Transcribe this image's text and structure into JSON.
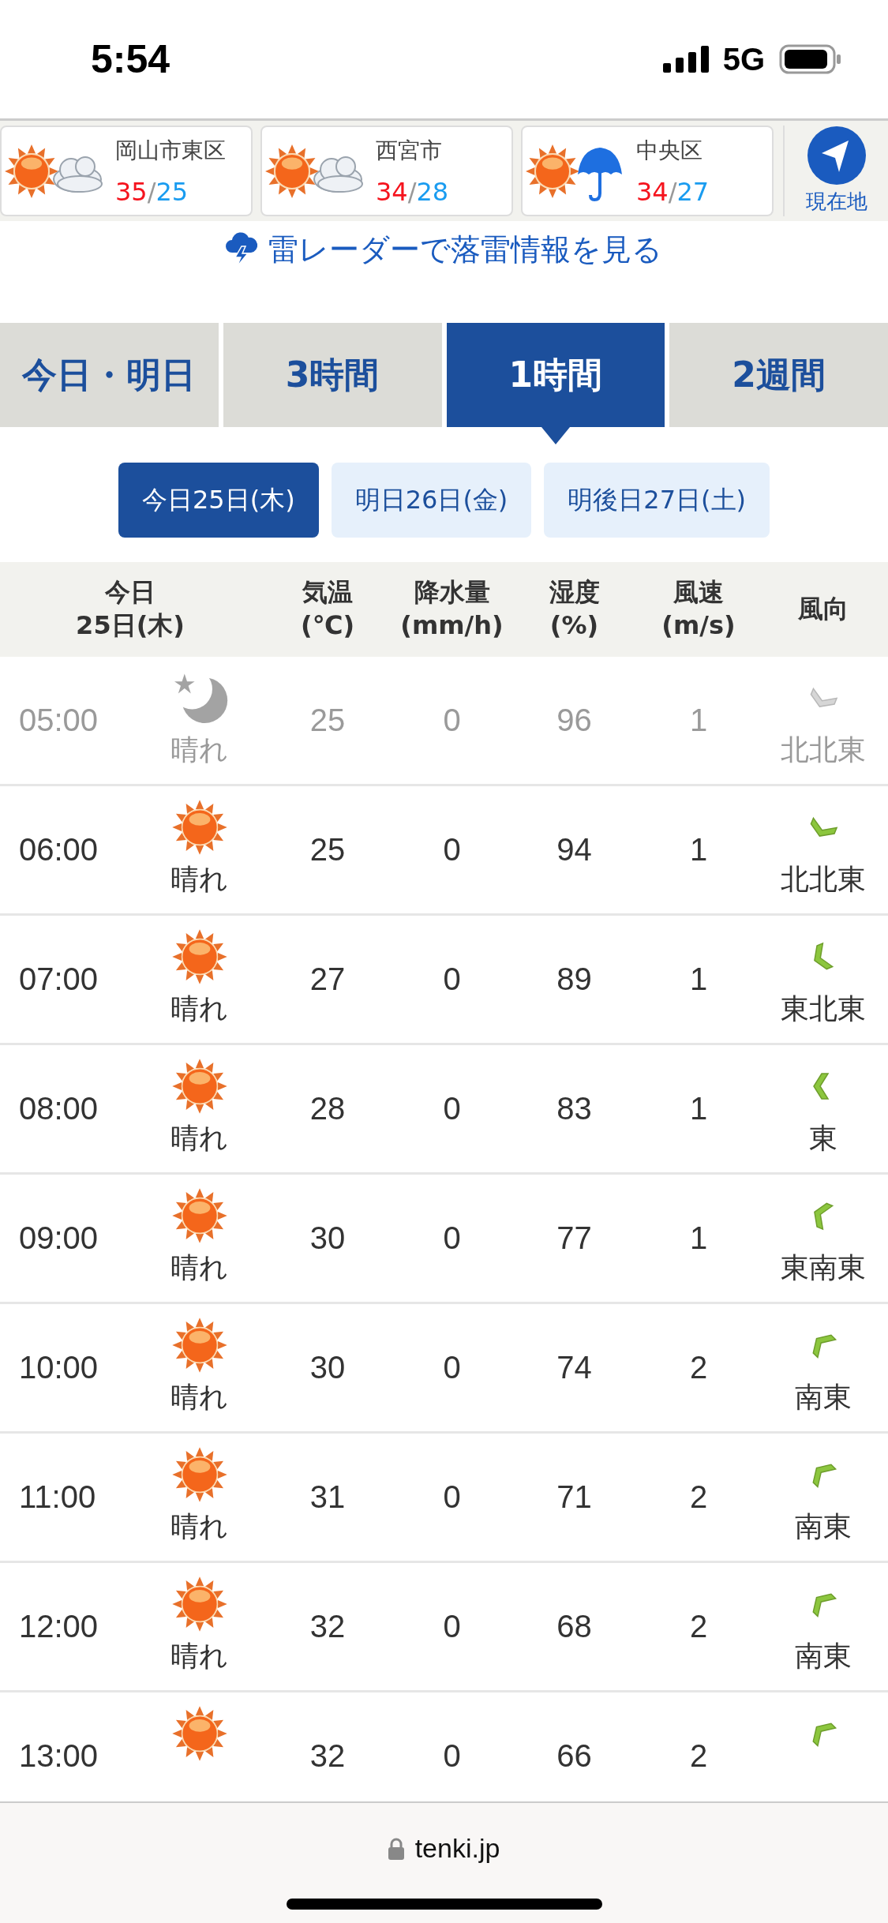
{
  "status_bar": {
    "time": "5:54",
    "network": "5G"
  },
  "locations": [
    {
      "name": "岡山市東区",
      "kind": "cloudy",
      "high": "35",
      "slash": "/",
      "low": "25"
    },
    {
      "name": "西宮市",
      "kind": "cloudy",
      "high": "34",
      "slash": "/",
      "low": "28"
    },
    {
      "name": "中央区",
      "kind": "rainy",
      "high": "34",
      "slash": "/",
      "low": "27"
    }
  ],
  "current_location": {
    "label": "現在地"
  },
  "radar_link": "雷レーダーで落雷情報を見る",
  "tabs": [
    {
      "label": "今日・明日",
      "selected": false
    },
    {
      "label": "3時間",
      "selected": false
    },
    {
      "label": "1時間",
      "selected": true
    },
    {
      "label": "2週間",
      "selected": false
    }
  ],
  "days": [
    {
      "label": "今日25日(木)",
      "selected": true
    },
    {
      "label": "明日26日(金)",
      "selected": false
    },
    {
      "label": "明後日27日(土)",
      "selected": false
    }
  ],
  "table": {
    "columns": [
      "今日\n25日(木)",
      "気温\n(℃)",
      "降水量\n(mm/h)",
      "湿度\n(%)",
      "風速\n(m/s)",
      "風向"
    ],
    "rows": [
      {
        "time": "05:00",
        "kind": "night",
        "weather": "晴れ",
        "temp": "25",
        "precip": "0",
        "humidity": "96",
        "wind_speed": "1",
        "wind": {
          "kind": "nne",
          "label": "北北東"
        },
        "past": true
      },
      {
        "time": "06:00",
        "kind": "sunny",
        "weather": "晴れ",
        "temp": "25",
        "precip": "0",
        "humidity": "94",
        "wind_speed": "1",
        "wind": {
          "kind": "nne",
          "label": "北北東"
        },
        "past": false
      },
      {
        "time": "07:00",
        "kind": "sunny",
        "weather": "晴れ",
        "temp": "27",
        "precip": "0",
        "humidity": "89",
        "wind_speed": "1",
        "wind": {
          "kind": "ene",
          "label": "東北東"
        },
        "past": false
      },
      {
        "time": "08:00",
        "kind": "sunny",
        "weather": "晴れ",
        "temp": "28",
        "precip": "0",
        "humidity": "83",
        "wind_speed": "1",
        "wind": {
          "kind": "e",
          "label": "東"
        },
        "past": false
      },
      {
        "time": "09:00",
        "kind": "sunny",
        "weather": "晴れ",
        "temp": "30",
        "precip": "0",
        "humidity": "77",
        "wind_speed": "1",
        "wind": {
          "kind": "ese",
          "label": "東南東"
        },
        "past": false
      },
      {
        "time": "10:00",
        "kind": "sunny",
        "weather": "晴れ",
        "temp": "30",
        "precip": "0",
        "humidity": "74",
        "wind_speed": "2",
        "wind": {
          "kind": "se",
          "label": "南東"
        },
        "past": false
      },
      {
        "time": "11:00",
        "kind": "sunny",
        "weather": "晴れ",
        "temp": "31",
        "precip": "0",
        "humidity": "71",
        "wind_speed": "2",
        "wind": {
          "kind": "se",
          "label": "南東"
        },
        "past": false
      },
      {
        "time": "12:00",
        "kind": "sunny",
        "weather": "晴れ",
        "temp": "32",
        "precip": "0",
        "humidity": "68",
        "wind_speed": "2",
        "wind": {
          "kind": "se",
          "label": "南東"
        },
        "past": false
      },
      {
        "time": "13:00",
        "kind": "sunny",
        "temp": "32",
        "precip": "0",
        "humidity": "66",
        "wind_speed": "2",
        "wind": {
          "kind": "se"
        },
        "past": false
      }
    ]
  },
  "address_bar": {
    "domain": "tenki.jp"
  }
}
